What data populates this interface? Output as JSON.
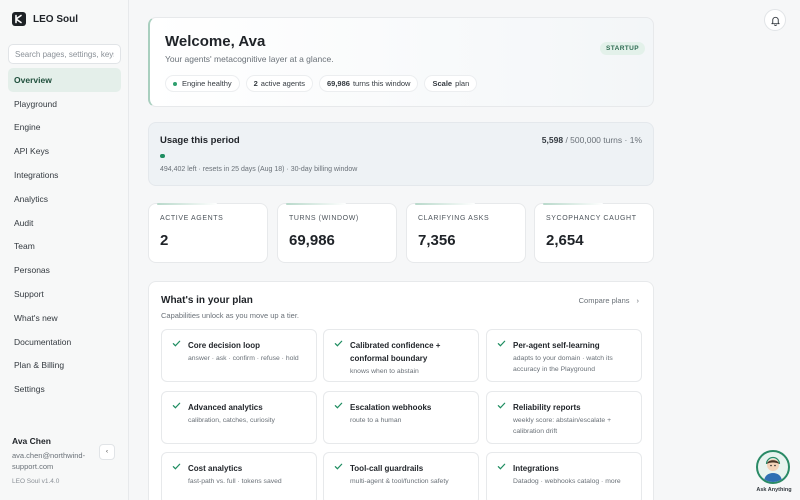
{
  "app": {
    "name": "LEO Soul",
    "version": "LEO Soul v1.4.0"
  },
  "sidebar": {
    "search_placeholder": "Search pages, settings, keys...",
    "items": [
      {
        "label": "Overview",
        "active": true
      },
      {
        "label": "Playground"
      },
      {
        "label": "Engine"
      },
      {
        "label": "API Keys"
      },
      {
        "label": "Integrations"
      },
      {
        "label": "Analytics"
      },
      {
        "label": "Audit"
      },
      {
        "label": "Team"
      },
      {
        "label": "Personas"
      },
      {
        "label": "Support"
      },
      {
        "label": "What's new"
      },
      {
        "label": "Documentation"
      },
      {
        "label": "Plan & Billing"
      },
      {
        "label": "Settings"
      }
    ],
    "user": {
      "name": "Ava Chen",
      "email": "ava.chen@northwind-support.com",
      "toggle": "‹"
    }
  },
  "welcome": {
    "title": "Welcome, Ava",
    "subtitle": "Your agents' metacognitive layer at a glance.",
    "badge": "STARTUP",
    "pills": {
      "engine": "Engine healthy",
      "agents_count": "2",
      "agents_label": "active agents",
      "turns_count": "69,986",
      "turns_label": "turns this window",
      "plan_label": "Scale",
      "plan_suffix": "plan"
    }
  },
  "usage": {
    "title": "Usage this period",
    "used": "5,598",
    "total": "/ 500,000 turns · 1%",
    "percent": 1,
    "meta": "494,402 left · resets in 25 days (Aug 18) · 30-day billing window"
  },
  "stats": [
    {
      "label": "ACTIVE AGENTS",
      "value": "2"
    },
    {
      "label": "TURNS (WINDOW)",
      "value": "69,986"
    },
    {
      "label": "CLARIFYING ASKS",
      "value": "7,356"
    },
    {
      "label": "SYCOPHANCY CAUGHT",
      "value": "2,654"
    }
  ],
  "plan": {
    "title": "What's in your plan",
    "subtitle": "Capabilities unlock as you move up a tier.",
    "compare": "Compare plans",
    "compare_arrow": "›",
    "features": [
      {
        "title": "Core decision loop",
        "desc": "answer · ask · confirm · refuse · hold"
      },
      {
        "title": "Calibrated confidence + conformal boundary",
        "desc": "knows when to abstain"
      },
      {
        "title": "Per-agent self-learning",
        "desc": "adapts to your domain · watch its accuracy in the Playground"
      },
      {
        "title": "Advanced analytics",
        "desc": "calibration, catches, curiosity"
      },
      {
        "title": "Escalation webhooks",
        "desc": "route to a human"
      },
      {
        "title": "Reliability reports",
        "desc": "weekly score: abstain/escalate + calibration drift"
      },
      {
        "title": "Cost analytics",
        "desc": "fast-path vs. full · tokens saved"
      },
      {
        "title": "Tool-call guardrails",
        "desc": "multi-agent & tool/function safety"
      },
      {
        "title": "Integrations",
        "desc": "Datadog · webhooks catalog · more"
      }
    ]
  },
  "assistant": {
    "label": "Ask Anything"
  },
  "colors": {
    "accent": "#1f8d61",
    "active_bg": "#e4efea",
    "badge_bg": "#e3f1ea"
  }
}
